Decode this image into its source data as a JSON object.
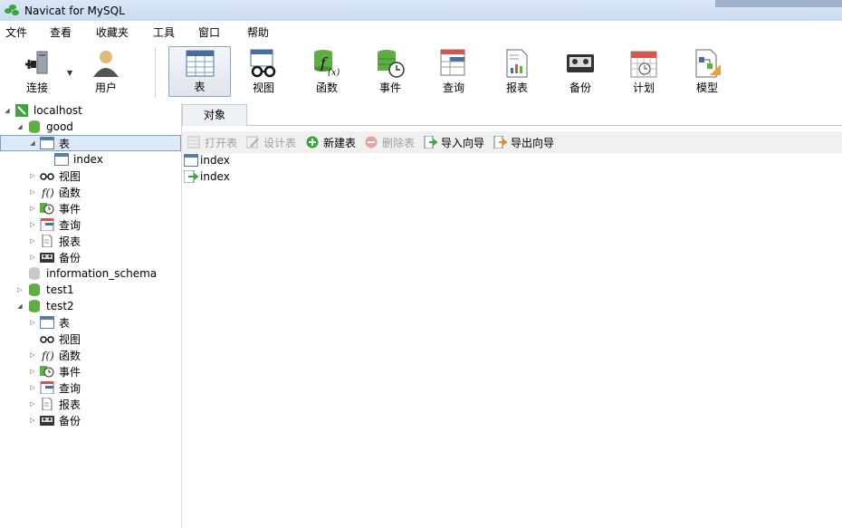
{
  "window": {
    "title": "Navicat for MySQL"
  },
  "menu": [
    "文件",
    "查看",
    "收藏夹",
    "工具",
    "窗口",
    "帮助"
  ],
  "toolbar": {
    "connect": "连接",
    "user": "用户",
    "table": "表",
    "view": "视图",
    "function": "函数",
    "event": "事件",
    "query": "查询",
    "report": "报表",
    "backup": "备份",
    "schedule": "计划",
    "model": "模型"
  },
  "tree": {
    "localhost": "localhost",
    "good": "good",
    "good_table": "表",
    "good_table_index": "index",
    "good_view": "视图",
    "good_function": "函数",
    "good_event": "事件",
    "good_query": "查询",
    "good_report": "报表",
    "good_backup": "备份",
    "information_schema": "information_schema",
    "test1": "test1",
    "test2": "test2",
    "test2_table": "表",
    "test2_view": "视图",
    "test2_function": "函数",
    "test2_event": "事件",
    "test2_query": "查询",
    "test2_report": "报表",
    "test2_backup": "备份"
  },
  "tab": {
    "objects": "对象"
  },
  "actions": {
    "open_table": "打开表",
    "design_table": "设计表",
    "new_table": "新建表",
    "delete_table": "删除表",
    "import_wizard": "导入向导",
    "export_wizard": "导出向导"
  },
  "objects": [
    "index",
    "index"
  ],
  "colors": {
    "accent_green": "#5fae44",
    "selection": "#dce9f7",
    "titlebar": "#c9d9ef"
  }
}
